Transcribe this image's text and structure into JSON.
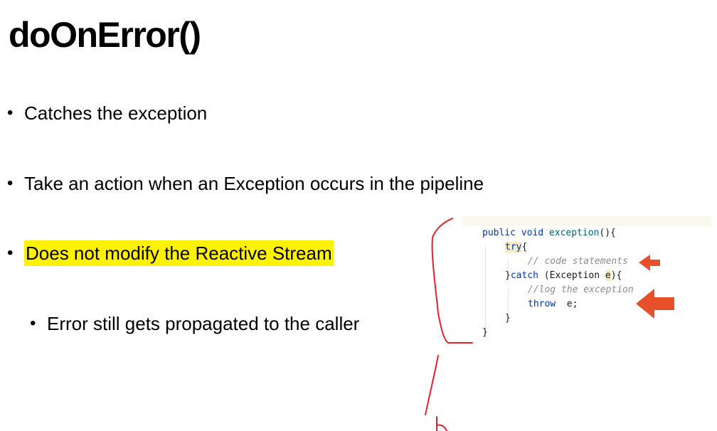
{
  "slide": {
    "title": "doOnError()",
    "bullets": [
      {
        "text": "Catches the exception"
      },
      {
        "text": "Take an action when an Exception occurs in the pipeline"
      },
      {
        "text": "Does not modify the Reactive Stream",
        "highlighted": true,
        "highlight_color": "#fff200"
      },
      {
        "text": "Error still gets propagated to the caller",
        "level": 2
      }
    ],
    "bullet_glyph": "•"
  },
  "code": {
    "line1_kw": "public void",
    "line1_fn": " exception",
    "line1_rest": "(){",
    "line2_kw": "try",
    "line2_rest": "{",
    "line3_comment": "// code statements",
    "line4_brace": "}",
    "line4_kw": "catch",
    "line4_mid": " (Exception ",
    "line4_var": "e",
    "line4_rest": "){",
    "line5_comment": "//log the exception",
    "line6_kw": "throw",
    "line6_rest": "  e;",
    "line7": "}",
    "line8": "}"
  },
  "colors": {
    "highlight": "#fff200",
    "annotation_red": "#e8202a",
    "arrow_orange": "#e8502a",
    "keyword": "#0033b3",
    "comment": "#8c8c8c"
  },
  "icons": [
    "arrow-left-icon",
    "arrow-left-icon"
  ]
}
